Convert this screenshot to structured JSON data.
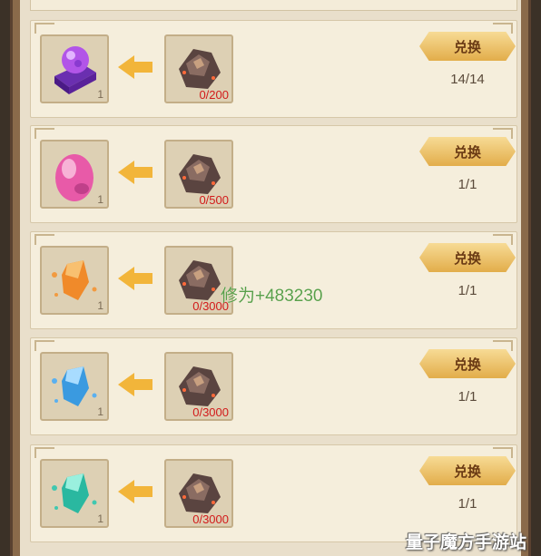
{
  "exchange_rows": [
    {
      "reward_item": "purple-orb-pedestal-icon",
      "reward_qty": "1",
      "cost_item": "ore-icon",
      "cost_count": "0/200",
      "button_label": "兑换",
      "limit": "14/14"
    },
    {
      "reward_item": "pink-egg-icon",
      "reward_qty": "1",
      "cost_item": "ore-icon",
      "cost_count": "0/500",
      "button_label": "兑换",
      "limit": "1/1"
    },
    {
      "reward_item": "orange-crystal-icon",
      "reward_qty": "1",
      "cost_item": "ore-icon",
      "cost_count": "0/3000",
      "button_label": "兑换",
      "limit": "1/1"
    },
    {
      "reward_item": "blue-crystal-icon",
      "reward_qty": "1",
      "cost_item": "ore-icon",
      "cost_count": "0/3000",
      "button_label": "兑换",
      "limit": "1/1"
    },
    {
      "reward_item": "teal-crystal-icon",
      "reward_qty": "1",
      "cost_item": "ore-icon",
      "cost_count": "0/3000",
      "button_label": "兑换",
      "limit": "1/1"
    }
  ],
  "floating_text": "修为+483230",
  "watermark": "量子魔方手游站",
  "colors": {
    "panel": "#e9dfcb",
    "row": "#f5eedc",
    "button": "#e2ad4a",
    "cost_text": "#d21a1a",
    "float_text": "#5aa04a"
  }
}
